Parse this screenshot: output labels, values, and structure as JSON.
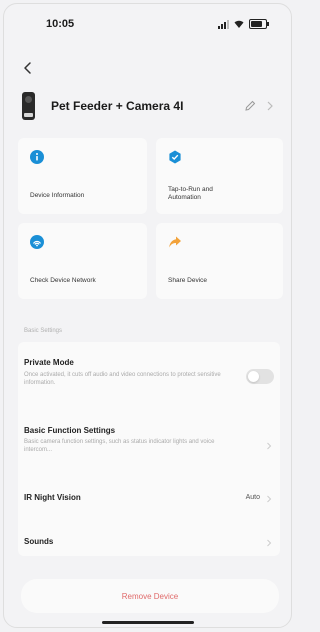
{
  "status_bar": {
    "time": "10:05"
  },
  "header": {
    "device_name": "Pet Feeder + Camera 4I"
  },
  "tiles": [
    {
      "label": "Device Information",
      "icon": "info-icon",
      "color": "#1a8fd6"
    },
    {
      "label": "Tap-to-Run and Automation",
      "icon": "automation-icon",
      "color": "#1a8fd6"
    },
    {
      "label": "Check Device Network",
      "icon": "network-icon",
      "color": "#1a8fd6"
    },
    {
      "label": "Share Device",
      "icon": "share-arrow-icon",
      "color": "#f2a23a"
    }
  ],
  "section": {
    "basic_settings_label": "Basic Settings"
  },
  "settings": {
    "private_mode": {
      "title": "Private Mode",
      "description": "Once activated, it cuts off audio and video connections to protect sensitive information.",
      "enabled": false
    },
    "basic_function": {
      "title": "Basic Function Settings",
      "description": "Basic camera function settings, such as status indicator lights and voice intercom..."
    },
    "ir_night_vision": {
      "title": "IR Night Vision",
      "value": "Auto"
    },
    "sounds": {
      "title": "Sounds"
    }
  },
  "remove_label": "Remove Device",
  "colors": {
    "accent": "#1a8fd6",
    "danger": "#e06a6a",
    "background": "#f3f3f5",
    "card": "#fafafa"
  }
}
